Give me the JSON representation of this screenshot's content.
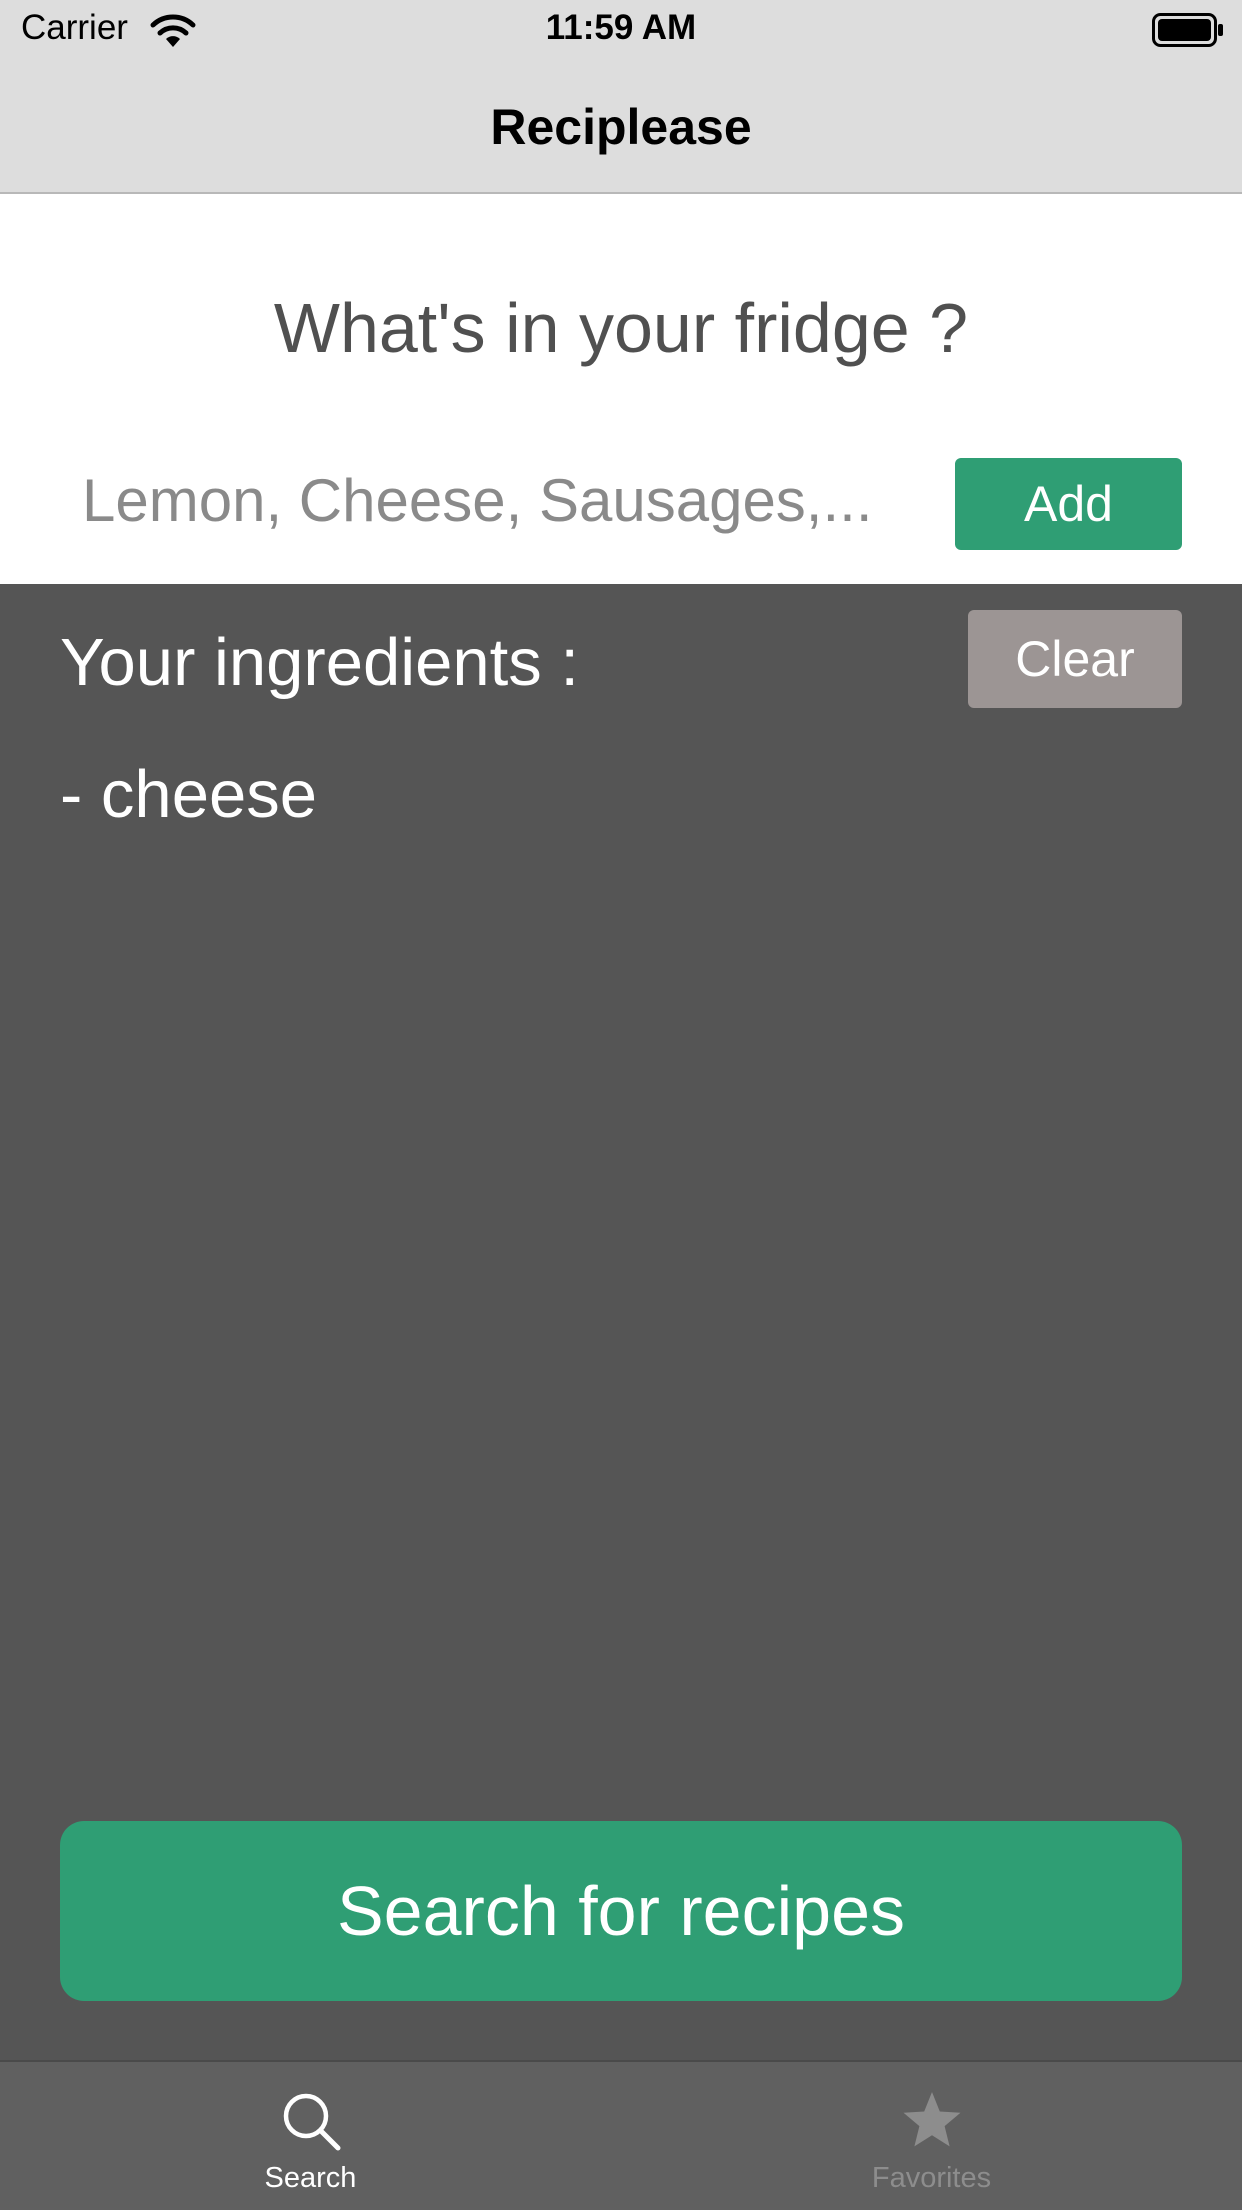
{
  "status_bar": {
    "carrier": "Carrier",
    "time": "11:59 AM",
    "wifi_icon": "wifi-icon",
    "battery_icon": "battery-icon"
  },
  "nav": {
    "title": "Reciplease"
  },
  "search_form": {
    "question": "What's in your fridge ?",
    "input_placeholder": "Lemon, Cheese, Sausages,...",
    "input_value": "",
    "add_label": "Add"
  },
  "ingredients": {
    "title": "Your ingredients :",
    "clear_label": "Clear",
    "items": [
      "- cheese"
    ]
  },
  "search_button_label": "Search for recipes",
  "tab_bar": {
    "tabs": [
      {
        "label": "Search",
        "icon": "search-icon",
        "selected": true
      },
      {
        "label": "Favorites",
        "icon": "star-icon",
        "selected": false
      }
    ]
  },
  "colors": {
    "accent": "#2f9e74",
    "clear_button": "#9c9594",
    "panel_background": "#555555",
    "bar_background": "#dddddd"
  }
}
